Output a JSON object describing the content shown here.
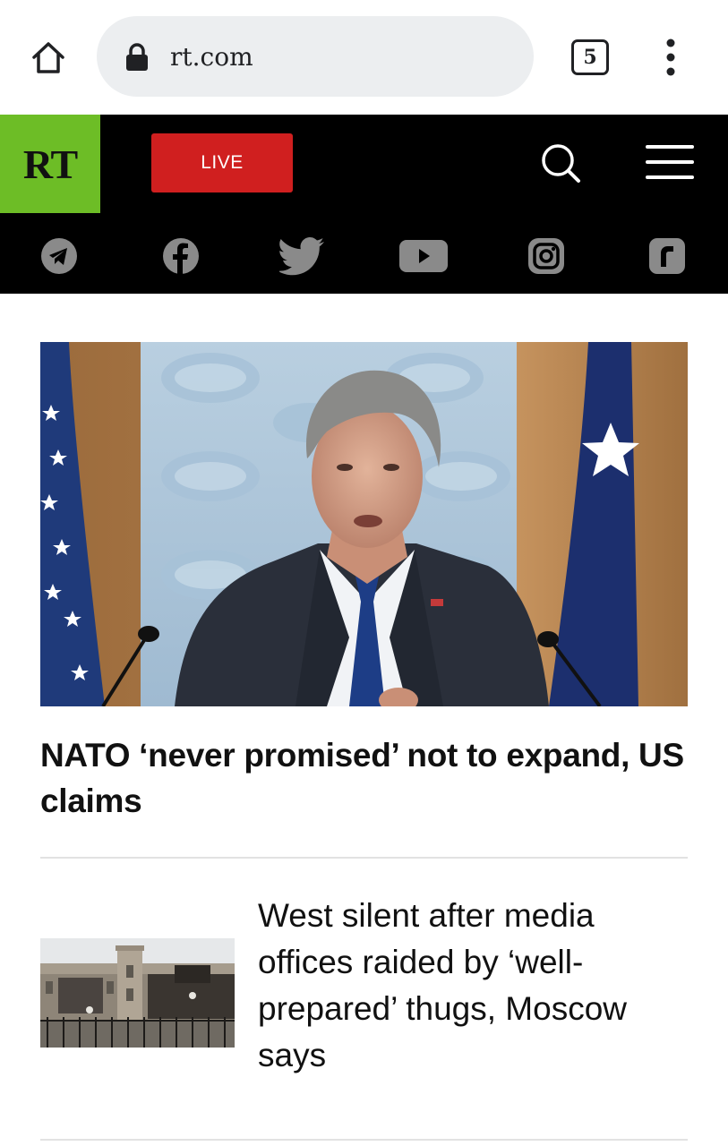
{
  "browser": {
    "url": "rt.com",
    "tab_count": "5"
  },
  "header": {
    "logo_text": "RT",
    "live_label": "LIVE",
    "logo_color": "#6dbd26",
    "live_color": "#d01f1f"
  },
  "social": [
    {
      "icon": "telegram-icon"
    },
    {
      "icon": "facebook-icon"
    },
    {
      "icon": "twitter-icon"
    },
    {
      "icon": "youtube-icon"
    },
    {
      "icon": "instagram-icon"
    },
    {
      "icon": "rumble-icon"
    }
  ],
  "articles": [
    {
      "title": "NATO ‘never promised’ not to expand, US claims"
    },
    {
      "title": "West silent after media offices raided by ‘well-prepared’ thugs, Moscow says"
    }
  ]
}
